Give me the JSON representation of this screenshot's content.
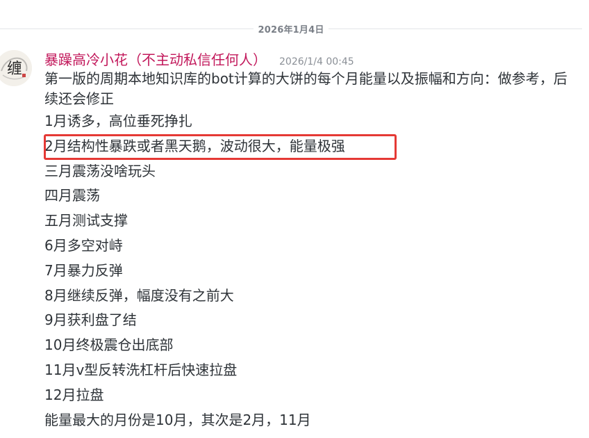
{
  "date_divider": "2026年1月4日",
  "message": {
    "username": "暴躁高冷小花（不主动私信任何人）",
    "timestamp": "2026/1/4 00:45",
    "intro": "第一版的周期本地知识库的bot计算的大饼的每个月能量以及振幅和方向：做参考，后续还会修正",
    "lines": [
      "1月诱多，高位垂死挣扎",
      "2月结构性暴跌或者黑天鹅，波动很大，能量极强",
      "三月震荡没啥玩头",
      "四月震荡",
      "五月测试支撑",
      "6月多空对峙",
      "7月暴力反弹",
      "8月继续反弹，幅度没有之前大",
      "9月获利盘了结",
      "10月终极震仓出底部",
      "11月v型反转洗杠杆后快速拉盘",
      "12月拉盘",
      "能量最大的月份是10月，其次是2月，11月"
    ]
  },
  "avatar": {
    "icon": "calligraphy-avatar-icon",
    "glyph": "缠"
  },
  "colors": {
    "username": "#c2185b",
    "highlight_border": "#e53935",
    "text": "#2e3338",
    "meta": "#8a8f96"
  }
}
